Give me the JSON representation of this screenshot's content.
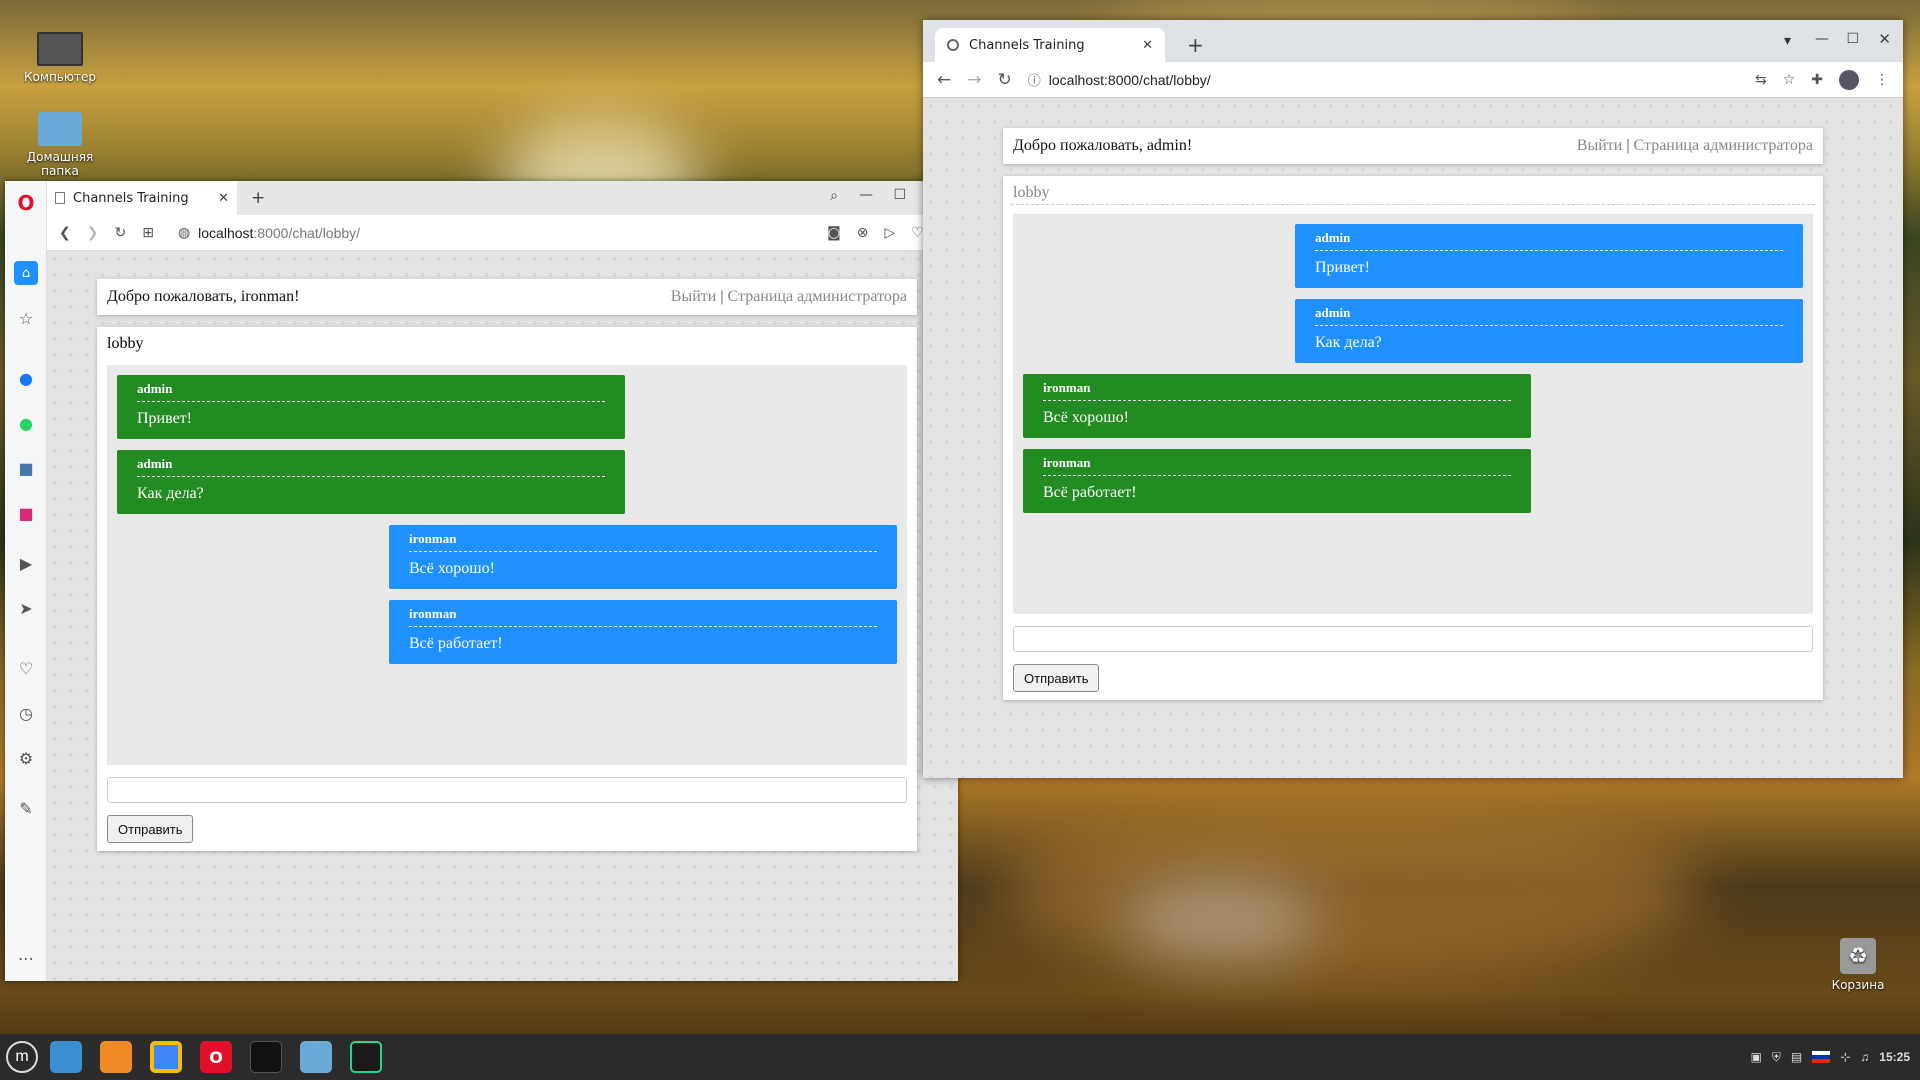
{
  "desktop": {
    "icons": [
      {
        "label": "Компьютер"
      },
      {
        "label": "Домашняя папка"
      },
      {
        "label": "Корзина"
      }
    ]
  },
  "opera_window": {
    "tab_title": "Channels Training",
    "url_host": "localhost",
    "url_rest": ":8000/chat/lobby/",
    "welcome": "Добро пожаловать, ironman!",
    "logout": "Выйти",
    "separator": "|",
    "admin_page": "Страница администратора",
    "room": "lobby",
    "messages": [
      {
        "author": "admin",
        "text": "Привет!",
        "color": "#228b22"
      },
      {
        "author": "admin",
        "text": "Как дела?",
        "color": "#228b22"
      },
      {
        "author": "ironman",
        "text": "Всё хорошо!",
        "color": "#1e90ff"
      },
      {
        "author": "ironman",
        "text": "Всё работает!",
        "color": "#1e90ff"
      }
    ],
    "input_value": "",
    "send_label": "Отправить"
  },
  "chrome_window": {
    "tab_title": "Channels Training",
    "url": "localhost:8000/chat/lobby/",
    "welcome": "Добро пожаловать, admin!",
    "logout": "Выйти",
    "separator": "|",
    "admin_page": "Страница администратора",
    "room": "lobby",
    "messages": [
      {
        "author": "admin",
        "text": "Привет!",
        "color": "#1e90ff"
      },
      {
        "author": "admin",
        "text": "Как дела?",
        "color": "#1e90ff"
      },
      {
        "author": "ironman",
        "text": "Всё хорошо!",
        "color": "#228b22"
      },
      {
        "author": "ironman",
        "text": "Всё работает!",
        "color": "#228b22"
      }
    ],
    "input_value": "",
    "send_label": "Отправить"
  },
  "taskbar": {
    "clock": "15:25"
  }
}
